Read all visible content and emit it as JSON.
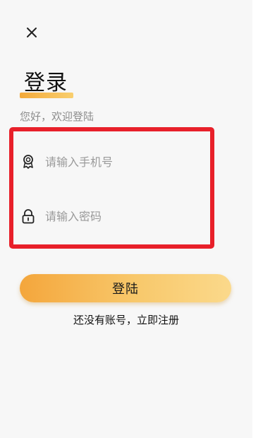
{
  "header": {
    "close_icon": "close-icon"
  },
  "title": {
    "text": "登录",
    "underline_colors": [
      "#f3a93a",
      "#f9cf6f"
    ]
  },
  "subtitle": "您好，欢迎登陆",
  "form": {
    "phone": {
      "icon": "user-badge-icon",
      "placeholder": "请输入手机号",
      "value": ""
    },
    "password": {
      "icon": "lock-icon",
      "placeholder": "请输入密码",
      "value": ""
    },
    "highlight_color": "#e8202a"
  },
  "actions": {
    "login_label": "登陆",
    "register_label": "还没有账号，立即注册"
  }
}
